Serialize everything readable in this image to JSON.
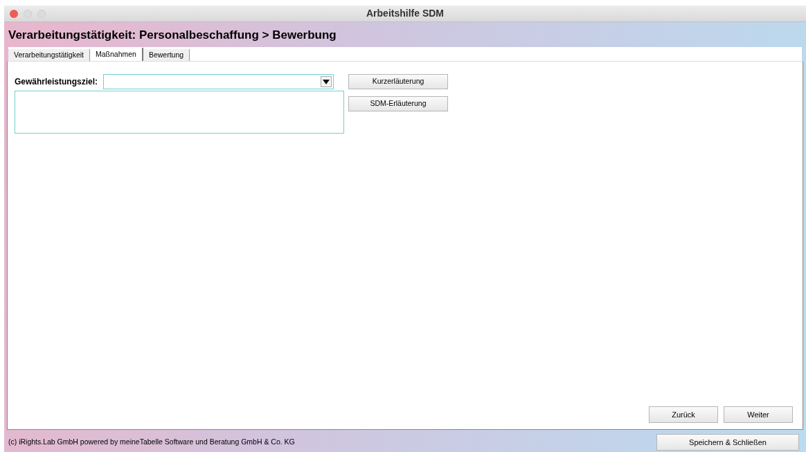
{
  "window": {
    "title": "Arbeitshilfe SDM"
  },
  "heading": "Verarbeitungstätigkeit: Personalbeschaffung > Bewerbung",
  "tabs": [
    {
      "label": "Verarbeitungstätigkeit",
      "selected": false
    },
    {
      "label": "Maßnahmen",
      "selected": true
    },
    {
      "label": "Bewertung",
      "selected": false
    }
  ],
  "form": {
    "label": "Gewährleistungsziel:",
    "buttons": [
      "Kurzerläuterung",
      "SDM-Erläuterung"
    ]
  },
  "nav_buttons": [
    "Zurück",
    "Weiter"
  ],
  "footer": {
    "text": "(c) iRights.Lab GmbH powered by meineTabelle Software und Beratung GmbH & Co. KG",
    "button": "Speichern & Schließen"
  }
}
